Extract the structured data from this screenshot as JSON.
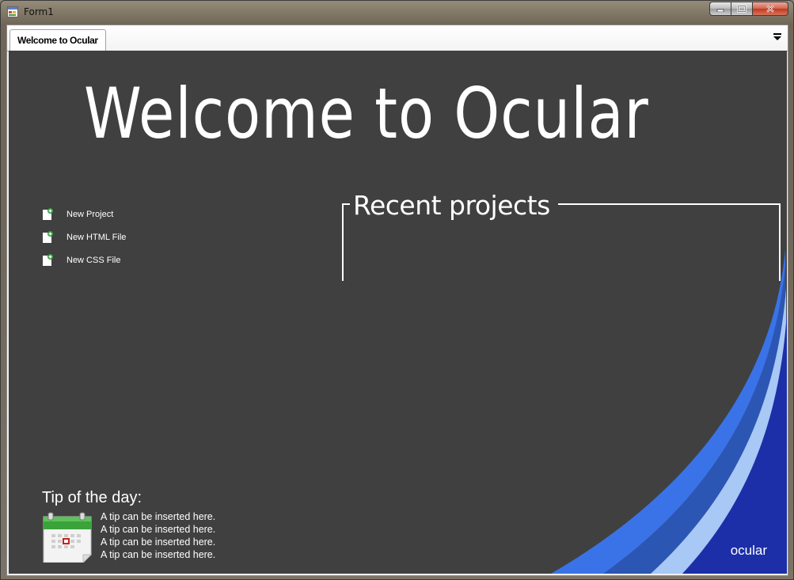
{
  "window": {
    "title": "Form1"
  },
  "tabs": [
    {
      "label": "Welcome to Ocular"
    }
  ],
  "hero": {
    "title": "Welcome to Ocular"
  },
  "actions": [
    {
      "label": "New Project"
    },
    {
      "label": "New HTML File"
    },
    {
      "label": "New CSS File"
    }
  ],
  "recent": {
    "title": "Recent projects",
    "items": []
  },
  "tip": {
    "title": "Tip of the day:",
    "lines": [
      "A tip can be inserted here.",
      "A tip can be inserted here.",
      "A tip can be inserted here.",
      "A tip can be inserted here."
    ]
  },
  "brand": "ocular",
  "colors": {
    "panel_bg": "#404040",
    "swoosh_light": "#3a73e8",
    "swoosh_mid": "#2c56b3",
    "swoosh_pale": "#a8c8f5",
    "swoosh_deep": "#1c2fa8"
  }
}
